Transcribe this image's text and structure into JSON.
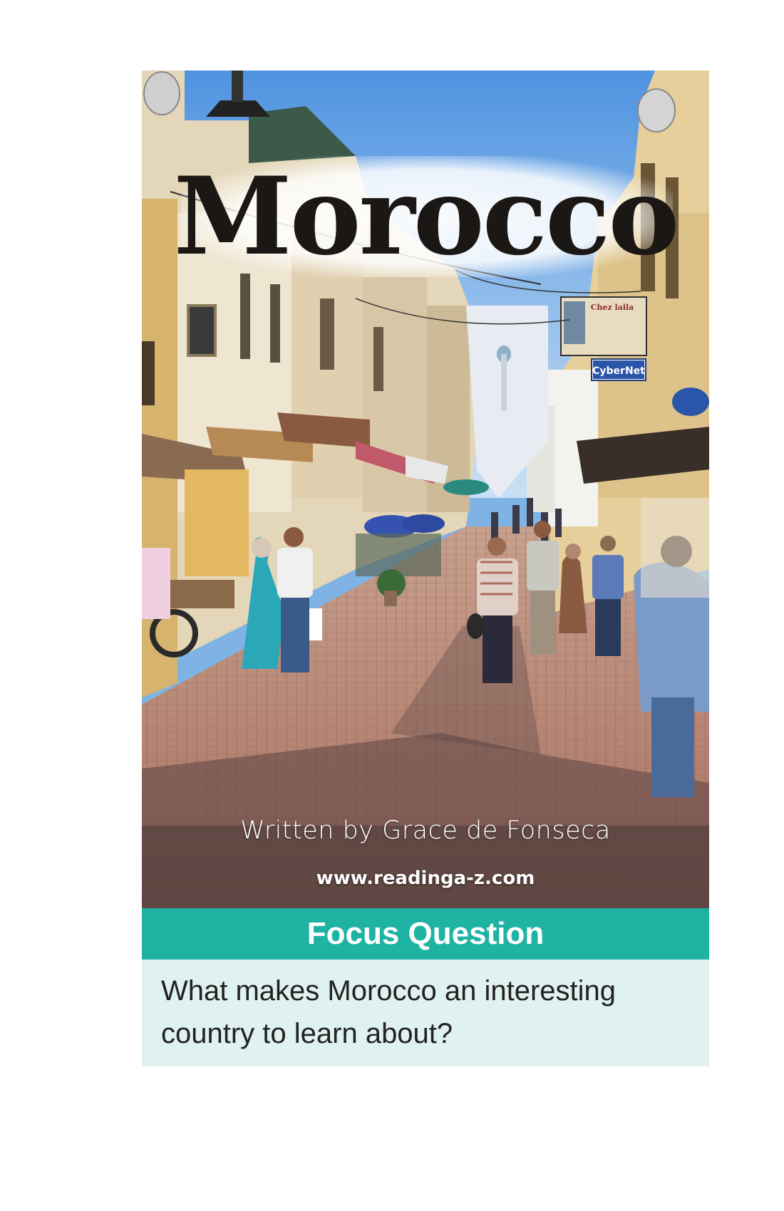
{
  "cover": {
    "title": "Morocco",
    "author_line": "Written by Grace de Fonseca",
    "website": "www.readinga-z.com",
    "sign_text": "Chez laila",
    "shop_sign": "CyberNet"
  },
  "focus": {
    "heading": "Focus Question",
    "question": "What makes Morocco an interesting country to learn about?"
  }
}
